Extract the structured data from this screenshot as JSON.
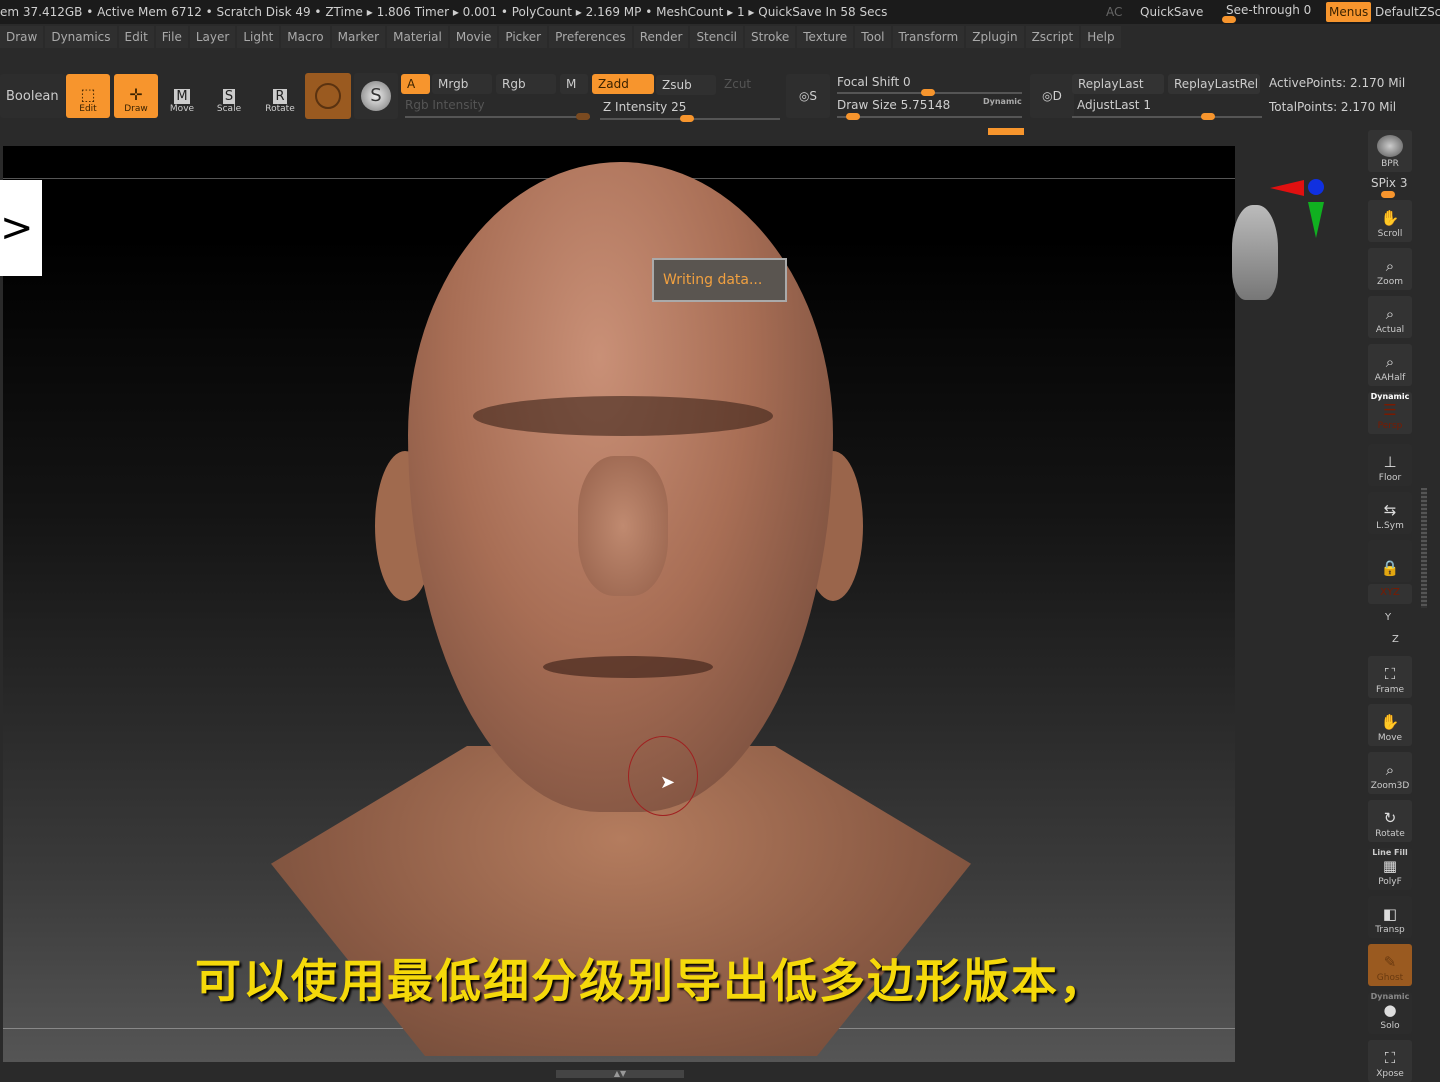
{
  "status": {
    "text": "em 37.412GB • Active Mem 6712 • Scratch Disk 49 •  ZTime ▸ 1.806 Timer ▸ 0.001 • PolyCount ▸ 2.169 MP  • MeshCount ▸ 1  ▸ QuickSave In 58 Secs",
    "ac": "AC",
    "quicksave": "QuickSave",
    "see_through": "See-through  0",
    "see_through_value": 0,
    "menus": "Menus",
    "default_script": "DefaultZScri"
  },
  "menu": [
    "Draw",
    "Dynamics",
    "Edit",
    "File",
    "Layer",
    "Light",
    "Macro",
    "Marker",
    "Material",
    "Movie",
    "Picker",
    "Preferences",
    "Render",
    "Stencil",
    "Stroke",
    "Texture",
    "Tool",
    "Transform",
    "Zplugin",
    "Zscript",
    "Help"
  ],
  "toolbar": {
    "boolean": "Boolean",
    "edit": "Edit",
    "draw": "Draw",
    "move": "Move",
    "scale": "Scale",
    "rotate": "Rotate",
    "a": "A",
    "mrgb": "Mrgb",
    "rgb": "Rgb",
    "m": "M",
    "zadd": "Zadd",
    "zsub": "Zsub",
    "zcut": "Zcut",
    "rgb_intensity": "Rgb Intensity",
    "z_intensity": "Z Intensity 25",
    "focal_shift": "Focal Shift 0",
    "draw_size": "Draw Size 5.75148",
    "dynamic": "Dynamic",
    "replay_last": "ReplayLast",
    "replay_last_rel": "ReplayLastRel",
    "adjust_last": "AdjustLast 1",
    "active_points": "ActivePoints: 2.170 Mil",
    "total_points": "TotalPoints: 2.170 Mil",
    "stroke_s": "S",
    "stroke_d": "D"
  },
  "viewport": {
    "writing_data": "Writing data...",
    "subtitle": "可以使用最低细分级别导出低多边形版本，"
  },
  "right_shelf": {
    "bpr": "BPR",
    "spix": "SPix 3",
    "buttons": [
      "Scroll",
      "Zoom",
      "Actual",
      "AAHalf",
      "Persp",
      "Floor",
      "L.Sym",
      "",
      "Frame",
      "Move",
      "Zoom3D",
      "Rotate",
      "PolyF",
      "Transp",
      "Ghost",
      "Solo",
      "Xpose"
    ],
    "persp_top": "Dynamic",
    "polyf_top": "Line Fill",
    "solo_top": "Dynamic",
    "xyz": "XYZ",
    "y": "Y",
    "z": "Z"
  },
  "colors": {
    "accent": "#f7952d",
    "subtitle": "#f5d90a"
  }
}
